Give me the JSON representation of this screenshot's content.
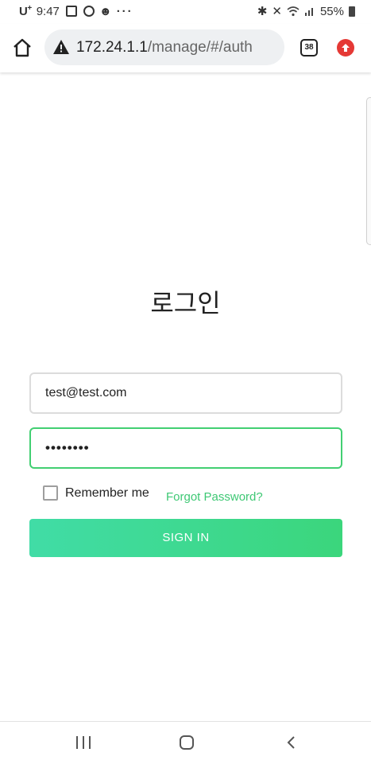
{
  "status_bar": {
    "carrier": "U",
    "carrier_sup": "+",
    "time": "9:47",
    "more": "···",
    "battery": "55%",
    "icons": [
      "gallery-icon",
      "alarm-icon",
      "face-icon",
      "bluetooth-icon",
      "mute-icon",
      "wifi-icon",
      "signal-icon",
      "battery-icon"
    ]
  },
  "browser": {
    "url_host": "172.24.1.1",
    "url_path": "/manage/#/auth",
    "tab_count": "38",
    "icons": [
      "home-icon",
      "warning-icon",
      "update-icon"
    ]
  },
  "login": {
    "title": "로그인",
    "email_value": "test@test.com",
    "password_value": "••••••••",
    "remember_label": "Remember me",
    "remember_checked": false,
    "forgot_label": "Forgot Password?",
    "signin_label": "SIGN IN"
  },
  "nav_bar": {
    "icons": [
      "recents-icon",
      "home-icon",
      "back-icon"
    ]
  },
  "colors": {
    "accent": "#3ec874",
    "button_gradient_start": "#41dca6",
    "button_gradient_end": "#3bd67c",
    "focus_border": "#42cf72",
    "update_badge": "#e53935"
  }
}
